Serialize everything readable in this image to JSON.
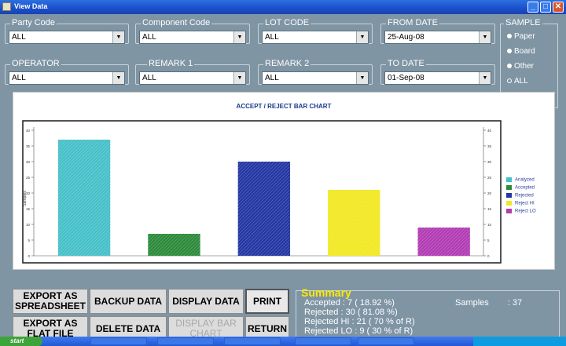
{
  "window": {
    "title": "View Data"
  },
  "filters": {
    "party_code": {
      "label": "Party Code",
      "value": "ALL"
    },
    "component_code": {
      "label": "Component Code",
      "value": "ALL"
    },
    "lot_code": {
      "label": "LOT CODE",
      "value": "ALL"
    },
    "from_date": {
      "label": "FROM DATE",
      "value": "25-Aug-08"
    },
    "operator": {
      "label": "OPERATOR",
      "value": "ALL"
    },
    "remark1": {
      "label": "REMARK 1",
      "value": "ALL"
    },
    "remark2": {
      "label": "REMARK 2",
      "value": "ALL"
    },
    "to_date": {
      "label": "TO DATE",
      "value": "01-Sep-08"
    }
  },
  "sample": {
    "label": "SAMPLE",
    "options": [
      "Paper",
      "Board",
      "Other",
      "ALL"
    ],
    "selected": "ALL"
  },
  "chart_data": {
    "type": "bar",
    "title": "ACCEPT / REJECT BAR CHART",
    "ylabel": "Samples",
    "ylim": [
      0,
      40
    ],
    "yticks": [
      0,
      5,
      10,
      15,
      20,
      25,
      30,
      35,
      40
    ],
    "categories": [
      "Analyzed",
      "Accepted",
      "Rejected",
      "Reject HI",
      "Reject LO"
    ],
    "values": [
      37,
      7,
      30,
      21,
      9
    ],
    "colors": [
      "#46c0c8",
      "#2c8a3a",
      "#2336a3",
      "#f2e822",
      "#b23bb4"
    ],
    "legend_position": "right"
  },
  "buttons": {
    "export_spreadsheet": "EXPORT AS SPREADSHEET",
    "backup": "BACKUP DATA",
    "display": "DISPLAY DATA",
    "print": "PRINT",
    "export_flat": "EXPORT AS FLAT FILE",
    "delete": "DELETE DATA",
    "display_bar_chart": "DISPLAY BAR CHART",
    "return": "RETURN"
  },
  "summary": {
    "heading": "Summary",
    "accepted": "Accepted : 7 ( 18.92 %)",
    "rejected": "Rejected : 30 ( 81.08 %)",
    "rejected_hi": "Rejected HI : 21 ( 70 % of R)",
    "rejected_lo": "Rejected LO : 9 ( 30 % of R)",
    "samples_label": "Samples",
    "samples_value": ": 37"
  },
  "taskbar": {
    "start": "start"
  }
}
